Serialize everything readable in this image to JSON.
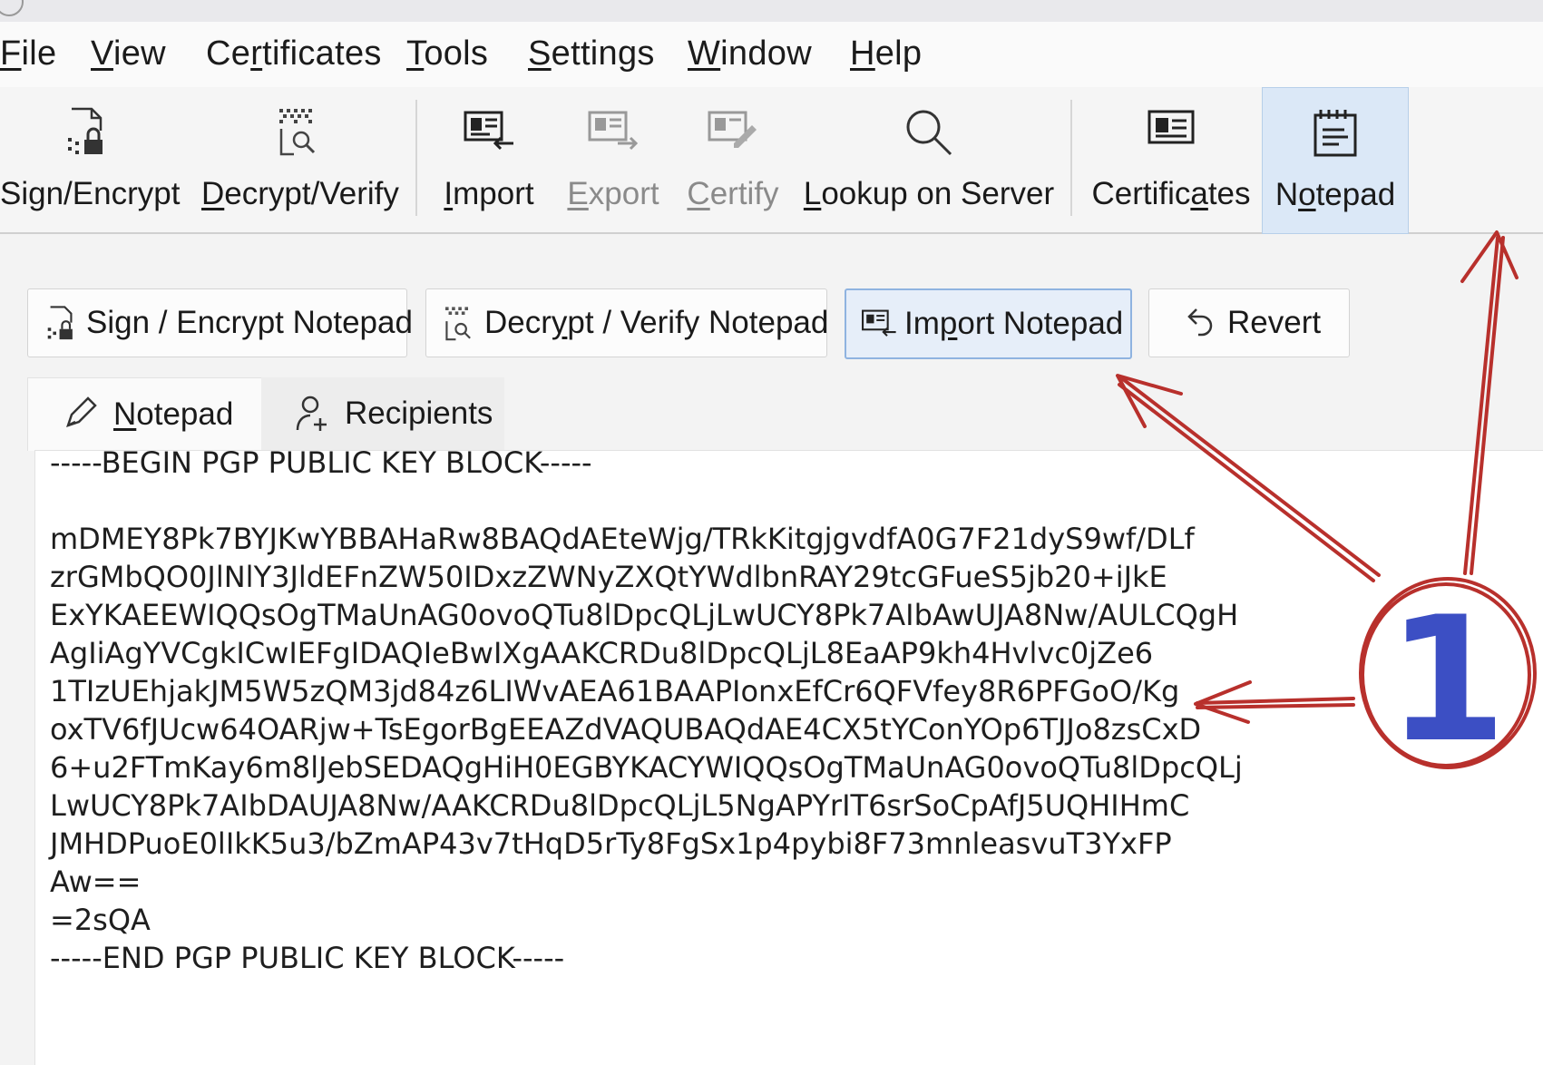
{
  "menu": {
    "file": "File",
    "view": "View",
    "certificates": "Certificates",
    "tools": "Tools",
    "settings": "Settings",
    "window": "Window",
    "help": "Help"
  },
  "toolbar": {
    "sign_encrypt": "Sign/Encrypt",
    "decrypt_verify": "Decrypt/Verify",
    "import": "Import",
    "export": "Export",
    "certify": "Certify",
    "lookup": "Lookup on Server",
    "certificates": "Certificates",
    "notepad": "Notepad"
  },
  "actions": {
    "sign_encrypt_notepad": "Sign / Encrypt Notepad",
    "decrypt_verify_notepad": "Decrypt / Verify Notepad",
    "import_notepad": "Import Notepad",
    "revert": "Revert"
  },
  "tabs": {
    "notepad": "Notepad",
    "recipients": "Recipients"
  },
  "editor_lines": [
    "-----BEGIN PGP PUBLIC KEY BLOCK-----",
    "",
    "mDMEY8Pk7BYJKwYBBAHaRw8BAQdAEteWjg/TRkKitgjgvdfA0G7F21dyS9wf/DLf",
    "zrGMbQO0JlNlY3JldEFnZW50IDxzZWNyZXQtYWdlbnRAY29tcGFueS5jb20+iJkE",
    "ExYKAEEWIQQsOgTMaUnAG0ovoQTu8lDpcQLjLwUCY8Pk7AIbAwUJA8Nw/AULCQgH",
    "AgIiAgYVCgkICwIEFgIDAQIeBwIXgAAKCRDu8lDpcQLjL8EaAP9kh4Hvlvc0jZe6",
    "1TIzUEhjakJM5W5zQM3jd84z6LIWvAEA61BAAPIonxEfCr6QFVfey8R6PFGoO/Kg",
    "oxTV6fJUcw64OARjw+TsEgorBgEEAZdVAQUBAQdAE4CX5tYConYOp6TJJo8zsCxD",
    "6+u2FTmKay6m8lJebSEDAQgHiH0EGBYKACYWIQQsOgTMaUnAG0ovoQTu8lDpcQLj",
    "LwUCY8Pk7AIbDAUJA8Nw/AAKCRDu8lDpcQLjL5NgAPYrIT6srSoCpAfJ5UQHIHmC",
    "JMHDPuoE0lIkK5u3/bZmAP43v7tHqD5rTy8FgSx1p4pybi8F73mnleasvuT3YxFP",
    "Aw==",
    "=2sQA",
    "-----END PGP PUBLIC KEY BLOCK-----"
  ],
  "annotation": {
    "marker": "1",
    "arrow_color": "#b8302c",
    "marker_color": "#3c4fc4"
  },
  "colors": {
    "active_toolbar_bg": "#dbe8f7",
    "focused_button_bg": "#e6eef9"
  }
}
